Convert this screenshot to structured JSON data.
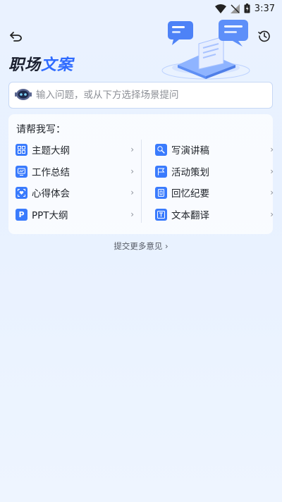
{
  "status": {
    "time": "3:37"
  },
  "header": {
    "title_part1": "职场",
    "title_part2": "文案",
    "back_icon": "back-arrow-icon",
    "history_icon": "history-icon"
  },
  "search": {
    "placeholder": "输入问题，或从下方选择场景提问"
  },
  "panel": {
    "title": "请帮我写：",
    "left_items": [
      {
        "label": "主题大纲",
        "icon": "grid-icon"
      },
      {
        "label": "工作总结",
        "icon": "monitor-icon"
      },
      {
        "label": "心得体会",
        "icon": "heart-frame-icon"
      },
      {
        "label": "PPT大纲",
        "icon": "p-letter-icon",
        "icon_text": "P"
      }
    ],
    "right_items": [
      {
        "label": "写演讲稿",
        "icon": "microphone-icon"
      },
      {
        "label": "活动策划",
        "icon": "flag-icon"
      },
      {
        "label": "回忆纪要",
        "icon": "document-icon"
      },
      {
        "label": "文本翻译",
        "icon": "t-letter-icon",
        "icon_text": "T"
      }
    ],
    "chevron": "›"
  },
  "feedback": {
    "label": "提交更多意见 ›"
  },
  "colors": {
    "accent": "#2f6bff",
    "icon_bg": "#3a7bfd"
  }
}
